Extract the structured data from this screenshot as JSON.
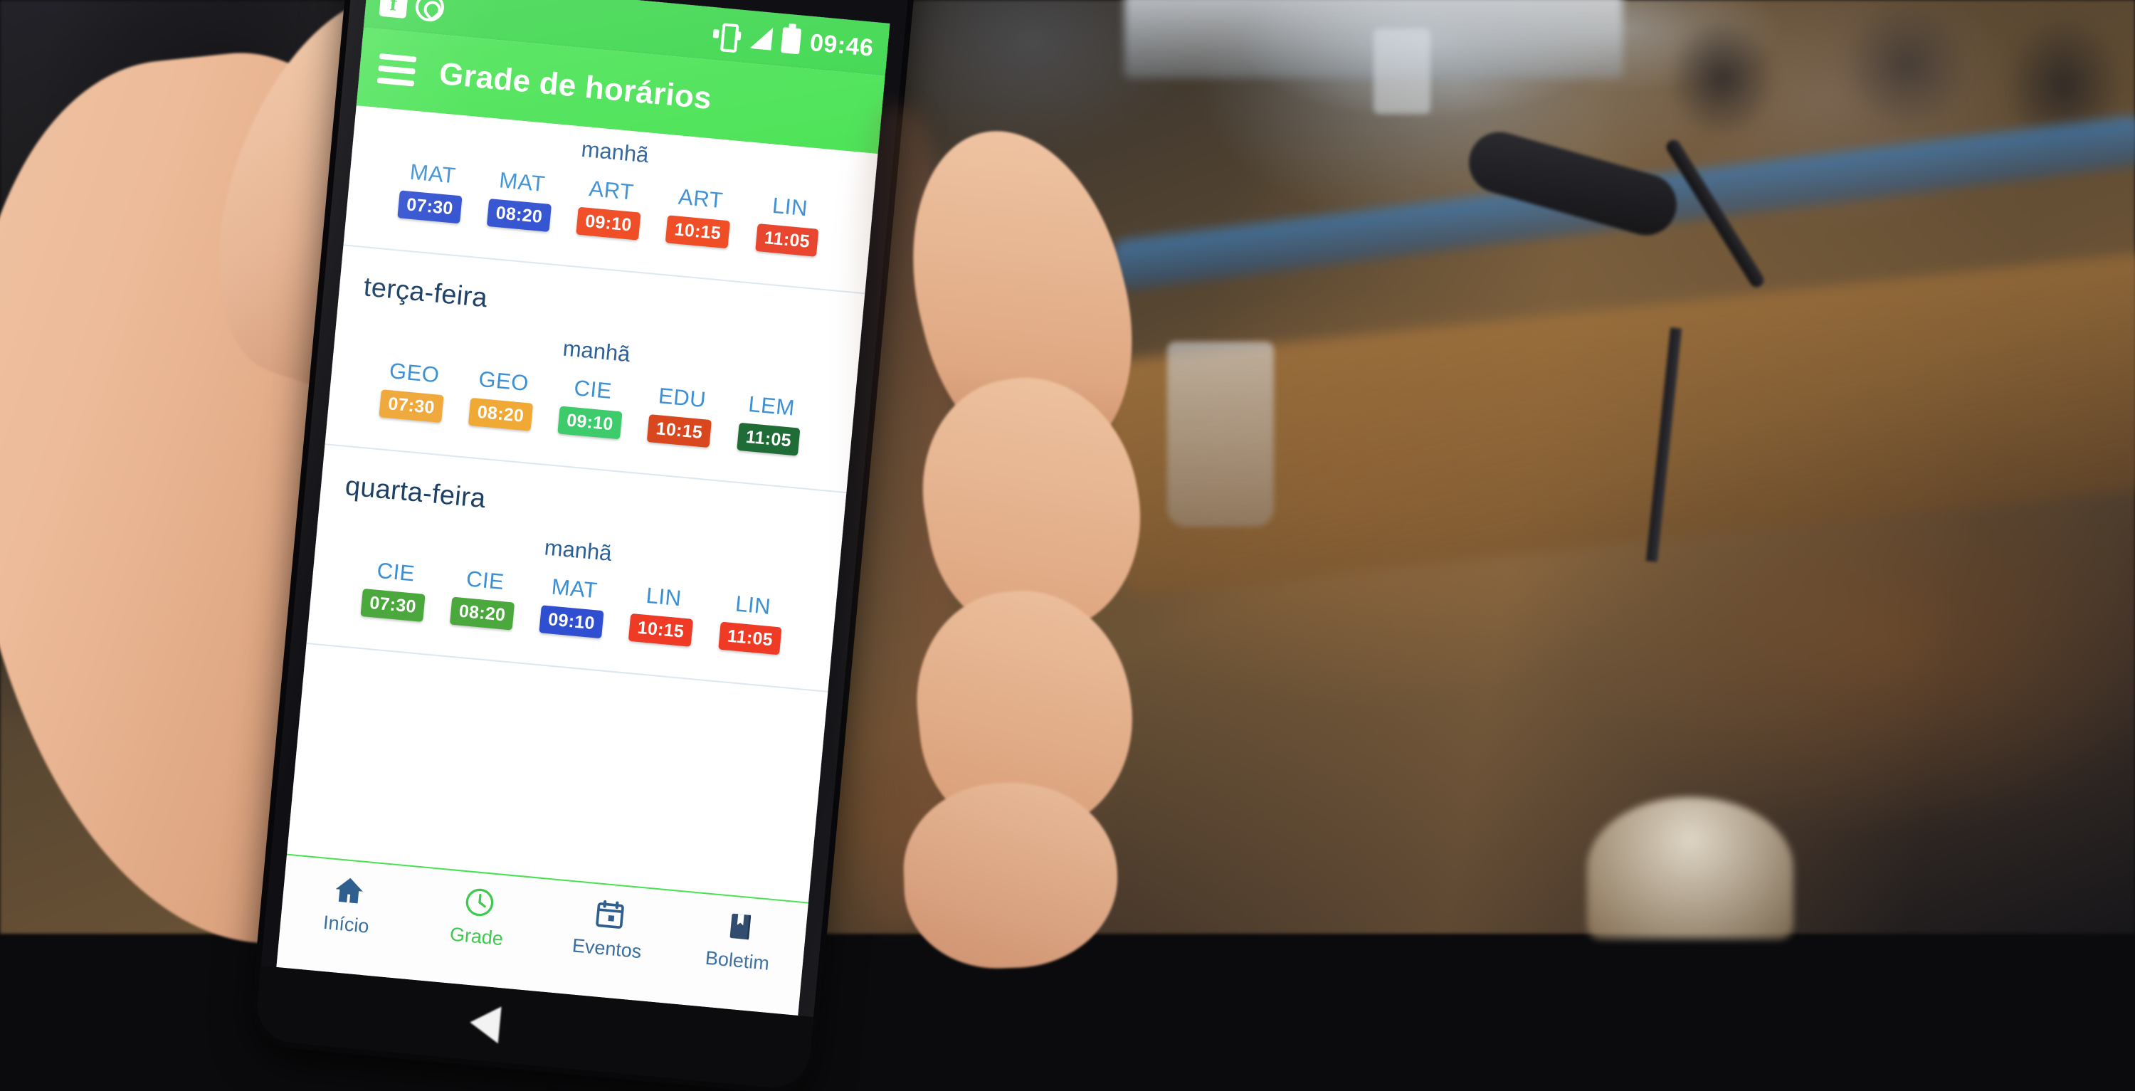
{
  "scene": {
    "description": "hand-holding-smartphone-in-conference-room"
  },
  "phone": {
    "statusbar": {
      "left_icons": [
        "facebook-icon",
        "whatsapp-icon"
      ],
      "right_icons": [
        "vibrate-icon",
        "signal-icon",
        "battery-icon"
      ],
      "time": "09:46"
    },
    "appbar": {
      "menu_icon": "hamburger-icon",
      "title": "Grade de horários"
    },
    "schedule": {
      "days": [
        {
          "name": "",
          "period": "manhã",
          "slots": [
            {
              "subject": "MAT",
              "time": "07:30",
              "color": "#2f4fd0"
            },
            {
              "subject": "MAT",
              "time": "08:20",
              "color": "#2f4fd0"
            },
            {
              "subject": "ART",
              "time": "09:10",
              "color": "#ef4a22"
            },
            {
              "subject": "ART",
              "time": "10:15",
              "color": "#ef4a22"
            },
            {
              "subject": "LIN",
              "time": "11:05",
              "color": "#e8432a"
            }
          ]
        },
        {
          "name": "terça-feira",
          "period": "manhã",
          "slots": [
            {
              "subject": "GEO",
              "time": "07:30",
              "color": "#f0a83a"
            },
            {
              "subject": "GEO",
              "time": "08:20",
              "color": "#efa832"
            },
            {
              "subject": "CIE",
              "time": "09:10",
              "color": "#3ccb6b"
            },
            {
              "subject": "EDU",
              "time": "10:15",
              "color": "#d8461c"
            },
            {
              "subject": "LEM",
              "time": "11:05",
              "color": "#1f6b36"
            }
          ]
        },
        {
          "name": "quarta-feira",
          "period": "manhã",
          "slots": [
            {
              "subject": "CIE",
              "time": "07:30",
              "color": "#4aa83c"
            },
            {
              "subject": "CIE",
              "time": "08:20",
              "color": "#4aa83c"
            },
            {
              "subject": "MAT",
              "time": "09:10",
              "color": "#2f4fd0"
            },
            {
              "subject": "LIN",
              "time": "10:15",
              "color": "#ef3b26"
            },
            {
              "subject": "LIN",
              "time": "11:05",
              "color": "#ef3b26"
            }
          ]
        }
      ]
    },
    "bottom_nav": {
      "items": [
        {
          "label": "Início",
          "icon": "home-icon",
          "active": false
        },
        {
          "label": "Grade",
          "icon": "clock-icon",
          "active": true
        },
        {
          "label": "Eventos",
          "icon": "calendar-icon",
          "active": false
        },
        {
          "label": "Boletim",
          "icon": "book-icon",
          "active": false
        }
      ]
    }
  },
  "colors": {
    "status_green": "#39d649",
    "appbar_green": "#46e251",
    "nav_active": "#3fc94f",
    "subject_text": "#3b8fd4",
    "day_text": "#1c3f63"
  }
}
